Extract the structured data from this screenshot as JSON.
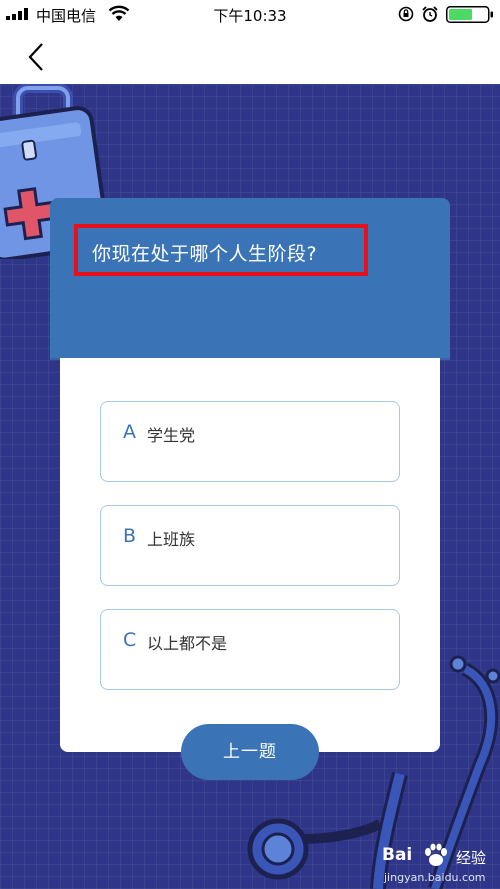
{
  "status_bar": {
    "carrier": "中国电信",
    "time": "下午10:33",
    "battery_color": "#4cd964"
  },
  "nav": {
    "back_icon": "chevron-left-icon"
  },
  "quiz": {
    "question": "你现在处于哪个人生阶段?",
    "options": [
      {
        "letter": "A",
        "text": "学生党"
      },
      {
        "letter": "B",
        "text": "上班族"
      },
      {
        "letter": "C",
        "text": "以上都不是"
      }
    ],
    "prev_button": "上一题"
  },
  "watermark": {
    "brand": "Bai",
    "brand_cn": "经验",
    "url": "jingyan.baidu.com"
  },
  "colors": {
    "background": "#2f3689",
    "accent": "#3a74b6",
    "highlight_border": "#e8101a"
  }
}
